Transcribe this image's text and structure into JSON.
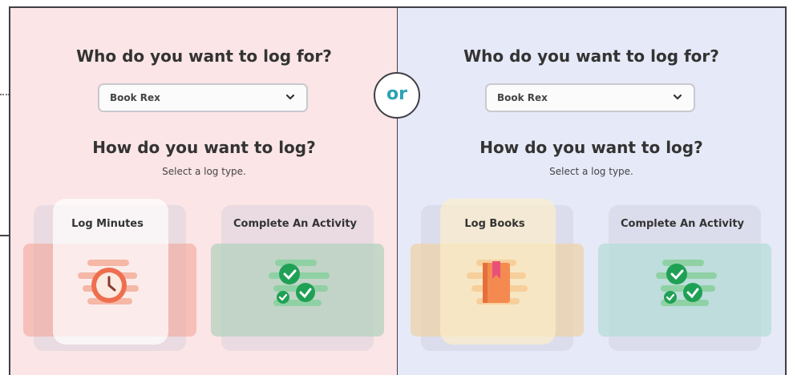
{
  "left": {
    "who_title": "Who do you want to log for?",
    "select_value": "Book Rex",
    "how_title": "How do you want to log?",
    "subtitle": "Select a log type.",
    "cards": [
      {
        "label": "Log Minutes",
        "icon": "clock-icon"
      },
      {
        "label": "Complete An Activity",
        "icon": "checkmarks-icon"
      }
    ]
  },
  "right": {
    "who_title": "Who do you want to log for?",
    "select_value": "Book Rex",
    "how_title": "How do you want to log?",
    "subtitle": "Select a log type.",
    "cards": [
      {
        "label": "Log Books",
        "icon": "book-icon"
      },
      {
        "label": "Complete An Activity",
        "icon": "checkmarks-icon"
      }
    ]
  },
  "divider_label": "or",
  "colors": {
    "left_bg": "#fbe5e6",
    "right_bg": "#e6e9f7",
    "accent_teal": "#2aa3b3",
    "minutes_tile": "#f3b9b2",
    "activity_tile": "#c6ddd0",
    "books_tile": "#f2d9b8"
  }
}
